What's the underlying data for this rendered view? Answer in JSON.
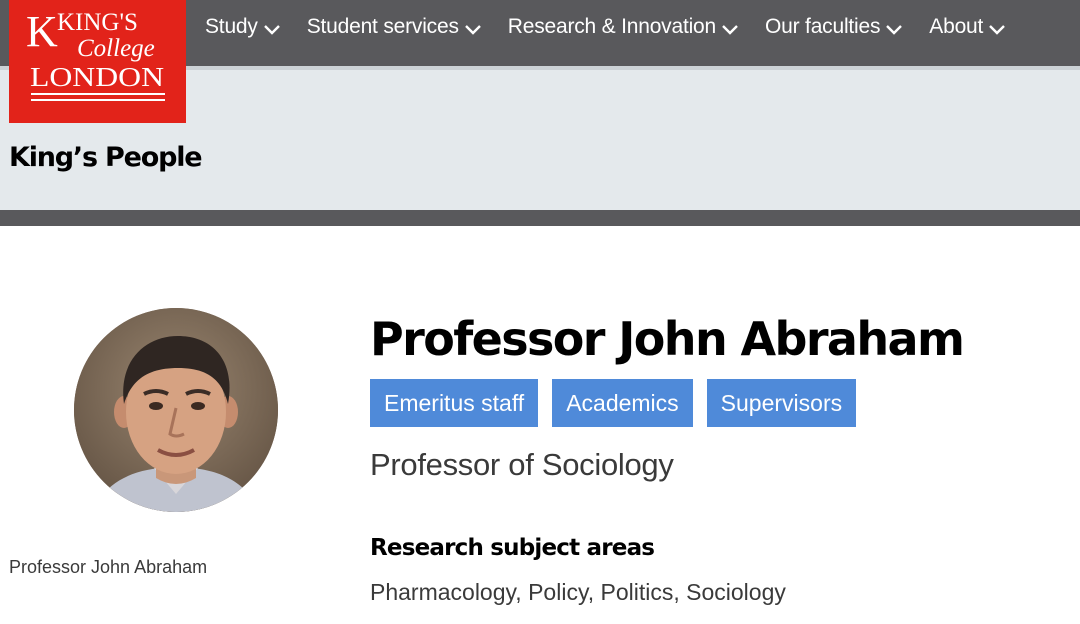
{
  "logo": {
    "line1": "KING'S",
    "line2": "College",
    "line3": "LONDON",
    "color": "#e2231a"
  },
  "nav": {
    "items": [
      {
        "label": "Study",
        "icon": "chevron-down-icon"
      },
      {
        "label": "Student services",
        "icon": "chevron-down-icon"
      },
      {
        "label": "Research & Innovation",
        "icon": "chevron-down-icon"
      },
      {
        "label": "Our faculties",
        "icon": "chevron-down-icon"
      },
      {
        "label": "About",
        "icon": "chevron-down-icon"
      }
    ],
    "background": "#59595c"
  },
  "site_title": "King’s People",
  "profile": {
    "photo_caption": "Professor John Abraham",
    "name": "Professor John Abraham",
    "tags": [
      "Emeritus staff",
      "Academics",
      "Supervisors"
    ],
    "tag_color": "#4f8ad9",
    "job_title": "Professor of Sociology",
    "research_heading": "Research subject areas",
    "research_areas": "Pharmacology, Policy, Politics, Sociology"
  }
}
